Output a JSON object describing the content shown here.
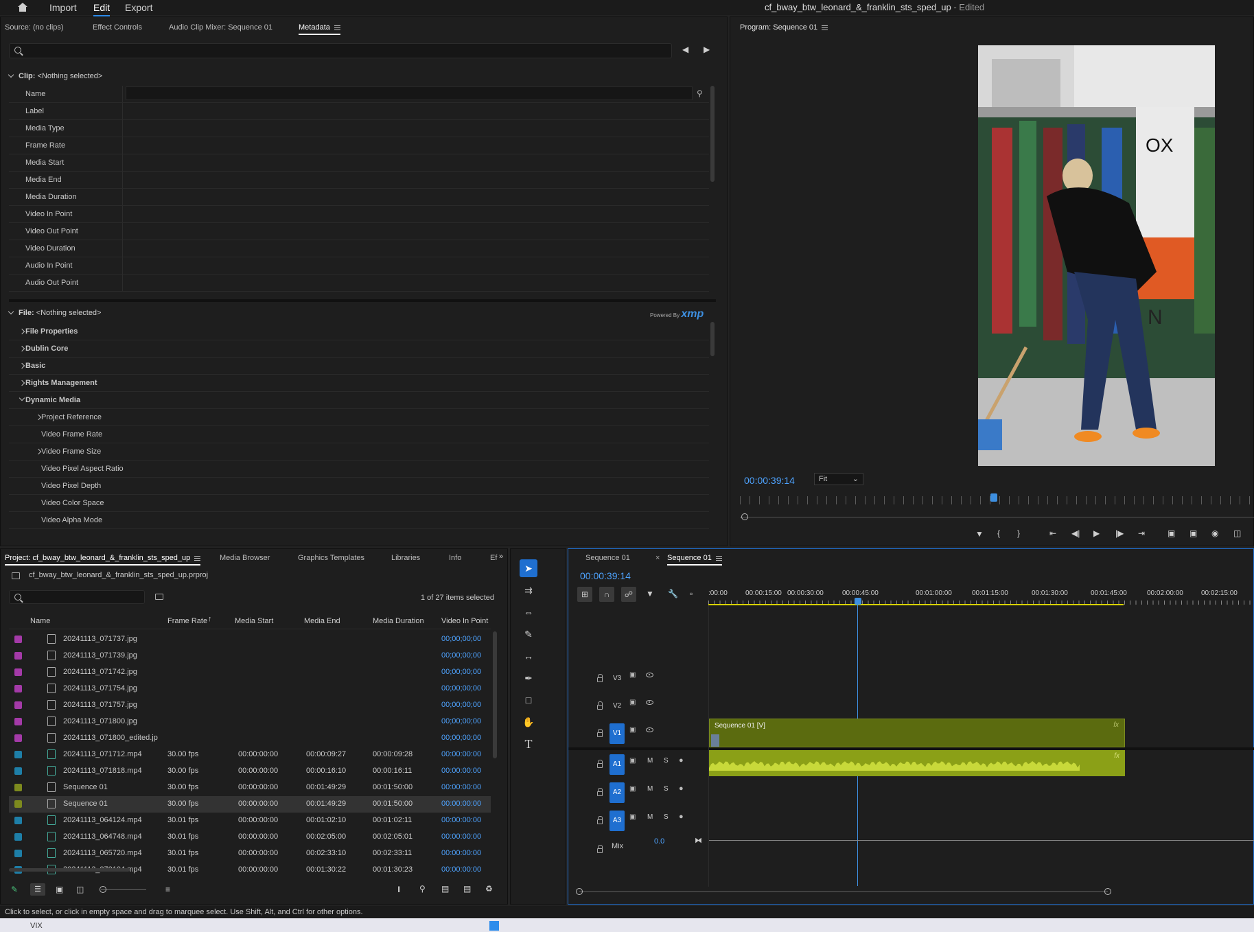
{
  "menu": {
    "home_icon": "home-icon",
    "import": "Import",
    "edit": "Edit",
    "export": "Export"
  },
  "document": {
    "title": "cf_bway_btw_leonard_&_franklin_sts_sped_up",
    "status": " - Edited"
  },
  "source_panel": {
    "tabs": [
      "Source: (no clips)",
      "Effect Controls",
      "Audio Clip Mixer: Sequence 01",
      "Metadata"
    ],
    "clip_header_label": "Clip:",
    "clip_header_value": "<Nothing selected>",
    "fields": [
      "Name",
      "Label",
      "Media Type",
      "Frame Rate",
      "Media Start",
      "Media End",
      "Media Duration",
      "Video In Point",
      "Video Out Point",
      "Video Duration",
      "Audio In Point",
      "Audio Out Point"
    ],
    "file_header_label": "File:",
    "file_header_value": "<Nothing selected>",
    "powered_by": "Powered By",
    "xmp": "xmp",
    "file_sections": [
      {
        "label": "File Properties",
        "level": 0,
        "expandable": true
      },
      {
        "label": "Dublin Core",
        "level": 0,
        "expandable": true
      },
      {
        "label": "Basic",
        "level": 0,
        "expandable": true
      },
      {
        "label": "Rights Management",
        "level": 0,
        "expandable": true
      },
      {
        "label": "Dynamic Media",
        "level": 0,
        "expanded": true
      },
      {
        "label": "Project Reference",
        "level": 1,
        "expandable": true
      },
      {
        "label": "Video Frame Rate",
        "level": 1
      },
      {
        "label": "Video Frame Size",
        "level": 1,
        "expandable": true
      },
      {
        "label": "Video Pixel Aspect Ratio",
        "level": 1
      },
      {
        "label": "Video Pixel Depth",
        "level": 1
      },
      {
        "label": "Video Color Space",
        "level": 1
      },
      {
        "label": "Video Alpha Mode",
        "level": 1
      }
    ]
  },
  "program_monitor": {
    "title": "Program: Sequence 01",
    "timecode": "00:00:39:14",
    "fit": "Fit",
    "overlay_text": "OX",
    "overlay_text2": "N"
  },
  "project_panel": {
    "tabs": [
      "Project: cf_bway_btw_leonard_&_franklin_sts_sped_up",
      "Media Browser",
      "Graphics Templates",
      "Libraries",
      "Info",
      "Ef"
    ],
    "file": "cf_bway_btw_leonard_&_franklin_sts_sped_up.prproj",
    "selection_count": "1 of 27 items selected",
    "columns": [
      "Name",
      "Frame Rate",
      "Media Start",
      "Media End",
      "Media Duration",
      "Video In Point"
    ],
    "rows": [
      {
        "color": "#a43aa8",
        "type": "image",
        "name": "20241113_071737.jpg",
        "fps": "",
        "start": "",
        "end": "",
        "dur": "",
        "vin": "00;00;00;00"
      },
      {
        "color": "#a43aa8",
        "type": "image",
        "name": "20241113_071739.jpg",
        "fps": "",
        "start": "",
        "end": "",
        "dur": "",
        "vin": "00;00;00;00"
      },
      {
        "color": "#a43aa8",
        "type": "image",
        "name": "20241113_071742.jpg",
        "fps": "",
        "start": "",
        "end": "",
        "dur": "",
        "vin": "00;00;00;00"
      },
      {
        "color": "#a43aa8",
        "type": "image",
        "name": "20241113_071754.jpg",
        "fps": "",
        "start": "",
        "end": "",
        "dur": "",
        "vin": "00;00;00;00"
      },
      {
        "color": "#a43aa8",
        "type": "image",
        "name": "20241113_071757.jpg",
        "fps": "",
        "start": "",
        "end": "",
        "dur": "",
        "vin": "00;00;00;00"
      },
      {
        "color": "#a43aa8",
        "type": "image",
        "name": "20241113_071800.jpg",
        "fps": "",
        "start": "",
        "end": "",
        "dur": "",
        "vin": "00;00;00;00"
      },
      {
        "color": "#a43aa8",
        "type": "image",
        "name": "20241113_071800_edited.jp",
        "fps": "",
        "start": "",
        "end": "",
        "dur": "",
        "vin": "00;00;00;00"
      },
      {
        "color": "#1e7fa8",
        "type": "video",
        "name": "20241113_071712.mp4",
        "fps": "30.00 fps",
        "start": "00:00:00:00",
        "end": "00:00:09:27",
        "dur": "00:00:09:28",
        "vin": "00:00:00:00"
      },
      {
        "color": "#1e7fa8",
        "type": "video",
        "name": "20241113_071818.mp4",
        "fps": "30.00 fps",
        "start": "00:00:00:00",
        "end": "00:00:16:10",
        "dur": "00:00:16:11",
        "vin": "00:00:00:00"
      },
      {
        "color": "#7d8a1e",
        "type": "sequence",
        "name": "Sequence 01",
        "fps": "30.00 fps",
        "start": "00:00:00:00",
        "end": "00:01:49:29",
        "dur": "00:01:50:00",
        "vin": "00:00:00:00"
      },
      {
        "color": "#7d8a1e",
        "type": "sequence",
        "name": "Sequence 01",
        "fps": "30.00 fps",
        "start": "00:00:00:00",
        "end": "00:01:49:29",
        "dur": "00:01:50:00",
        "vin": "00:00:00:00",
        "selected": true
      },
      {
        "color": "#1e7fa8",
        "type": "video",
        "name": "20241113_064124.mp4",
        "fps": "30.01 fps",
        "start": "00:00:00:00",
        "end": "00:01:02:10",
        "dur": "00:01:02:11",
        "vin": "00:00:00:00"
      },
      {
        "color": "#1e7fa8",
        "type": "video",
        "name": "20241113_064748.mp4",
        "fps": "30.01 fps",
        "start": "00:00:00:00",
        "end": "00:02:05:00",
        "dur": "00:02:05:01",
        "vin": "00:00:00:00"
      },
      {
        "color": "#1e7fa8",
        "type": "video",
        "name": "20241113_065720.mp4",
        "fps": "30.01 fps",
        "start": "00:00:00:00",
        "end": "00:02:33:10",
        "dur": "00:02:33:11",
        "vin": "00:00:00:00"
      },
      {
        "color": "#1e7fa8",
        "type": "video",
        "name": "20241113_070104.mp4",
        "fps": "30.01 fps",
        "start": "00:00:00:00",
        "end": "00:01:30:22",
        "dur": "00:01:30:23",
        "vin": "00:00:00:00"
      }
    ]
  },
  "timeline": {
    "tabs": [
      "Sequence 01",
      "Sequence 01"
    ],
    "timecode": "00:00:39:14",
    "ruler": [
      ":00:00",
      "00:00:15:00",
      "00:00:30:00",
      "00:00:45:00",
      "00:01:00:00",
      "00:01:15:00",
      "00:01:30:00",
      "00:01:45:00",
      "00:02:00:00",
      "00:02:15:00"
    ],
    "tracks": {
      "v3": "V3",
      "v2": "V2",
      "v1": "V1",
      "a1": "A1",
      "a2": "A2",
      "a3": "A3",
      "mix": "Mix",
      "mix_value": "0.0",
      "m": "M",
      "s": "S"
    },
    "clip_label": "Sequence 01 [V]",
    "fx": "fx",
    "clip_color": "#5b6b0f",
    "audio_color": "#8ba017"
  },
  "status_bar": "Click to select, or click in empty space and drag to marquee select. Use Shift, Alt, and Ctrl for other options.",
  "taskbar": {
    "label": "VIX"
  }
}
